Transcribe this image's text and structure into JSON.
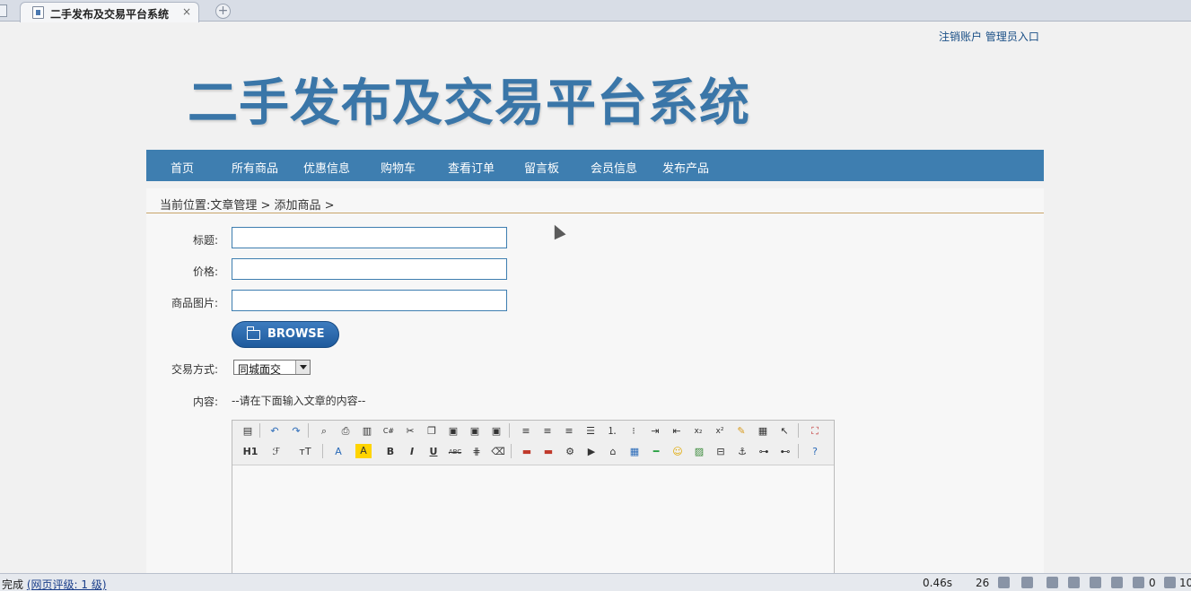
{
  "browser": {
    "tab_title": "二手发布及交易平台系统",
    "tab_close": "×",
    "new_tab": "+"
  },
  "header": {
    "logout_link": "注销账户",
    "admin_link": "管理员入口",
    "site_title": "二手发布及交易平台系统"
  },
  "nav": {
    "items": [
      "首页",
      "所有商品",
      "优惠信息",
      "购物车",
      "查看订单",
      "留言板",
      "会员信息",
      "发布产品"
    ]
  },
  "breadcrumb": "当前位置:文章管理 > 添加商品 >",
  "form": {
    "title_label": "标题:",
    "title_value": "",
    "price_label": "价格:",
    "price_value": "",
    "image_label": "商品图片:",
    "image_value": "",
    "browse_label": "BROWSE",
    "trade_label": "交易方式:",
    "trade_value": "同城面交",
    "content_label": "内容:",
    "content_hint": "--请在下面输入文章的内容--"
  },
  "editor": {
    "toolbar_row1": [
      "source-icon",
      "undo-icon",
      "redo-icon",
      "preview-icon",
      "print-icon",
      "template-icon",
      "code-icon",
      "cut-icon",
      "copy-icon",
      "paste-icon",
      "paste-plain-icon",
      "paste-word-icon",
      "align-left-icon",
      "align-center-icon",
      "align-right-icon",
      "align-justify-icon",
      "ordered-list-icon",
      "unordered-list-icon",
      "indent-icon",
      "outdent-icon",
      "subscript-icon",
      "superscript-icon",
      "clear-format-icon",
      "select-all-icon",
      "cursor-icon",
      "fullscreen-icon"
    ],
    "toolbar_row2": [
      "heading-icon",
      "font-family-icon",
      "font-size-icon",
      "font-color-icon",
      "highlight-icon",
      "bold-icon",
      "italic-icon",
      "underline-icon",
      "strikethrough-icon",
      "line-height-icon",
      "remove-format-icon",
      "image-icon",
      "multi-image-icon",
      "flash-icon",
      "media-icon",
      "attach-icon",
      "table-icon",
      "hr-icon",
      "emoticon-icon",
      "map-icon",
      "pagebreak-icon",
      "anchor-icon",
      "link-icon",
      "unlink-icon",
      "help-icon"
    ],
    "text": {
      "h1": "H1",
      "tT": "тT",
      "A": "A",
      "B": "B",
      "I": "I",
      "U": "U",
      "abc": "ABC"
    }
  },
  "statusbar": {
    "status": "完成",
    "rating": "(网页评级: 1 级)",
    "load_time": "0.46s",
    "count": "26",
    "block_count": "0",
    "zoom": "10"
  },
  "colors": {
    "nav_bg": "#3e7eb0",
    "logo": "#3a76a8",
    "link": "#1a4f86",
    "divider": "#c8a46a"
  }
}
